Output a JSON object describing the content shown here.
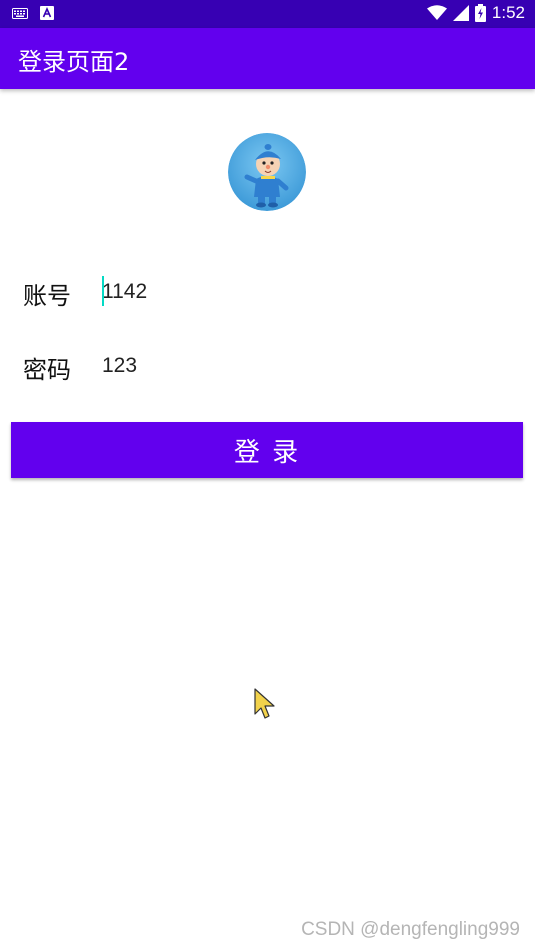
{
  "status_bar": {
    "time": "1:52",
    "left_icons": [
      "keyboard-icon",
      "a-notification-icon"
    ],
    "right_icons": [
      "wifi-icon",
      "signal-icon",
      "battery-icon"
    ]
  },
  "app_bar": {
    "title": "登录页面2",
    "color": "#6200ee"
  },
  "avatar": {
    "icon": "cartoon-character-avatar"
  },
  "form": {
    "account_label": "账号",
    "account_value": "1142",
    "password_label": "密码",
    "password_value": "123"
  },
  "login_button": {
    "label": "登 录",
    "color": "#6200ee"
  },
  "watermark": "CSDN @dengfengling999"
}
